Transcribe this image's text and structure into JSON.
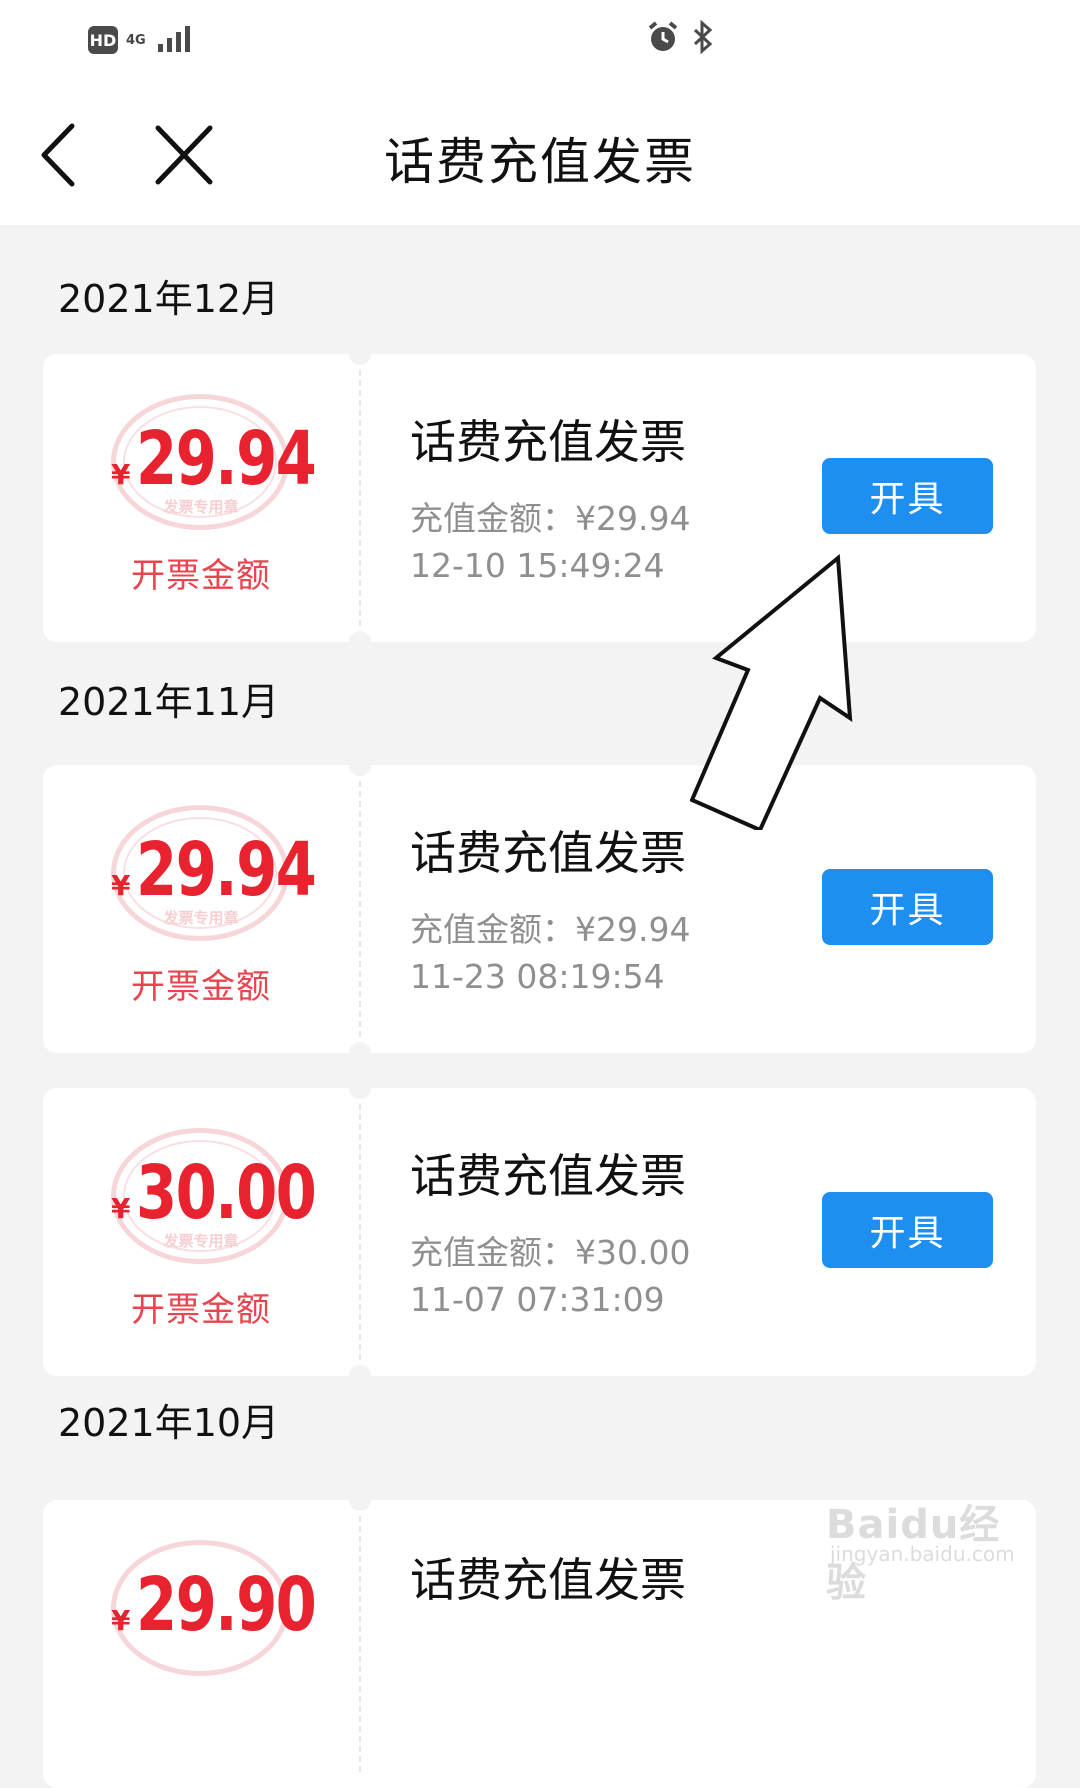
{
  "status_bar": {
    "hd": "HD",
    "network": "4G",
    "icons": [
      "alarm-icon",
      "bluetooth-icon"
    ]
  },
  "nav": {
    "title": "话费充值发票",
    "back_icon": "chevron-left-icon",
    "close_icon": "close-icon"
  },
  "months": [
    {
      "label": "2021年12月"
    },
    {
      "label": "2021年11月"
    },
    {
      "label": "2021年10月"
    }
  ],
  "invoices": [
    {
      "currency": "¥",
      "amount": "29.94",
      "amount_label": "开票金额",
      "title": "话费充值发票",
      "recharge_line": "充值金额：¥29.94",
      "time": "12-10 15:49:24",
      "button": "开具"
    },
    {
      "currency": "¥",
      "amount": "29.94",
      "amount_label": "开票金额",
      "title": "话费充值发票",
      "recharge_line": "充值金额：¥29.94",
      "time": "11-23 08:19:54",
      "button": "开具"
    },
    {
      "currency": "¥",
      "amount": "30.00",
      "amount_label": "开票金额",
      "title": "话费充值发票",
      "recharge_line": "充值金额：¥30.00",
      "time": "11-07 07:31:09",
      "button": "开具"
    },
    {
      "currency": "¥",
      "amount": "29.90",
      "title": "话费充值发票"
    }
  ],
  "stamp_text": "发票专用章",
  "watermark": {
    "brand": "Baidu经验",
    "url": "jingyan.baidu.com"
  },
  "colors": {
    "accent_blue": "#1e8ef0",
    "amount_red": "#e8232f",
    "background": "#f3f3f3"
  }
}
